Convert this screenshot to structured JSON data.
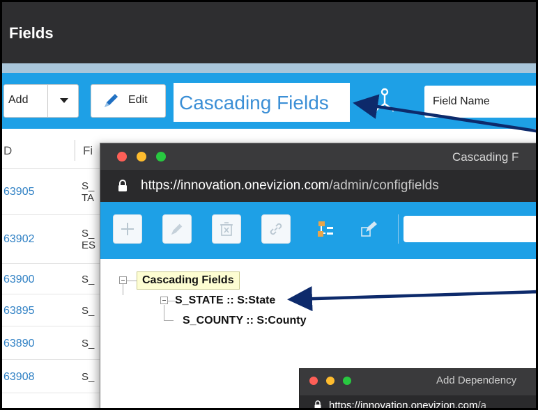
{
  "back_window": {
    "title": "Fields",
    "toolbar": {
      "add_label": "Add",
      "edit_label": "Edit",
      "title_callout": "Cascading Fields",
      "field_select_value": "Field Name"
    },
    "grid": {
      "columns": [
        "D",
        "Fi"
      ],
      "rows": [
        {
          "id": "63905",
          "name": [
            "S_",
            "TA"
          ]
        },
        {
          "id": "63902",
          "name": [
            "S_",
            "ES"
          ]
        },
        {
          "id": "63900",
          "name": [
            "S_",
            ""
          ]
        },
        {
          "id": "63895",
          "name": [
            "S_",
            ""
          ]
        },
        {
          "id": "63890",
          "name": [
            "S_",
            ""
          ]
        },
        {
          "id": "63908",
          "name": [
            "S_",
            ""
          ]
        }
      ]
    }
  },
  "popup": {
    "title": "Cascading F",
    "url_host": "https://innovation.onevizion.com",
    "url_path": "/admin/configfields",
    "tree": {
      "root": "Cascading Fields",
      "child": "S_STATE :: S:State",
      "grandchild": "S_COUNTY :: S:County"
    }
  },
  "dependency_window": {
    "title": "Add Dependency",
    "url_host": "https://innovation.onevizion.com",
    "url_path": "/a"
  },
  "colors": {
    "toolbar_blue": "#1ea0e6",
    "titlebar_dark": "#2e2e30",
    "link_blue": "#2f80c4",
    "title_blue": "#3b8fd6",
    "arrow_navy": "#0d2a6b",
    "tree_root_bg": "#fdfdd2"
  },
  "icons": [
    "pencil-icon",
    "caret-down-icon",
    "tree-structure-icon",
    "lock-icon",
    "plus-icon",
    "delete-icon",
    "link-icon",
    "hierarchy-icon",
    "edit-icon"
  ]
}
